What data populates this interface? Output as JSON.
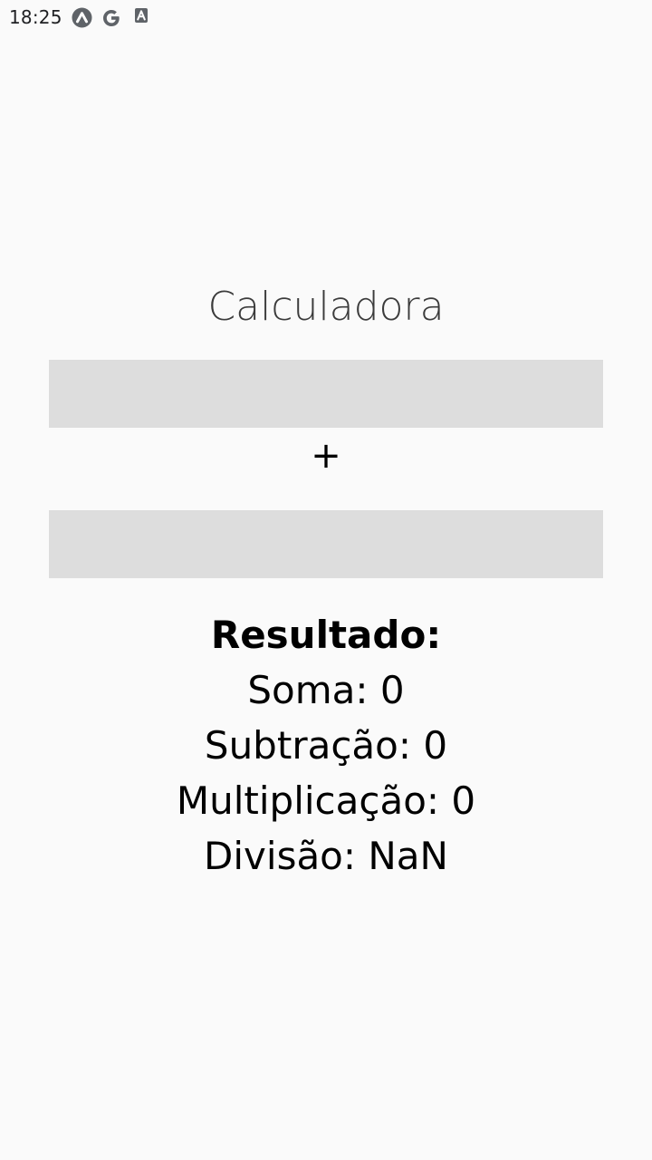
{
  "status_bar": {
    "time": "18:25",
    "icons": [
      "app-icon",
      "google-icon",
      "font-icon"
    ],
    "icon_color": "#5f6368"
  },
  "calculator": {
    "title": "Calculadora",
    "first_input": {
      "value": "",
      "placeholder": ""
    },
    "operator": "+",
    "second_input": {
      "value": "",
      "placeholder": ""
    }
  },
  "results": {
    "heading": "Resultado:",
    "lines": [
      "Soma: 0",
      "Subtração: 0",
      "Multiplicação: 0",
      "Divisão: NaN"
    ]
  },
  "colors": {
    "background": "#fafafa",
    "input_background": "#dddddd",
    "text": "#000000",
    "title_text": "#3b3b3b"
  }
}
